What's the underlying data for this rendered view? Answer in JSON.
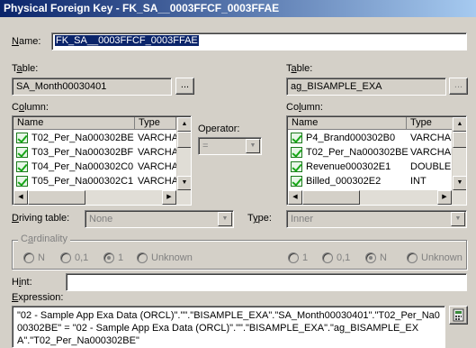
{
  "window": {
    "title": "Physical Foreign Key - FK_SA__0003FFCF_0003FFAE"
  },
  "name": {
    "label": "Name:",
    "value": "FK_SA__0003FFCF_0003FFAE"
  },
  "left": {
    "table_label": "Table:",
    "table_value": "SA_Month00030401",
    "browse_label": "...",
    "column_label": "Column:",
    "headers": {
      "name": "Name",
      "type": "Type"
    },
    "rows": [
      {
        "name": "T02_Per_Na000302BE",
        "type": "VARCHAR"
      },
      {
        "name": "T03_Per_Na000302BF",
        "type": "VARCHAR"
      },
      {
        "name": "T04_Per_Na000302C0",
        "type": "VARCHAR"
      },
      {
        "name": "T05_Per_Na000302C1",
        "type": "VARCHAR"
      }
    ]
  },
  "right": {
    "table_label": "Table:",
    "table_value": "ag_BISAMPLE_EXA",
    "browse_label": "...",
    "column_label": "Column:",
    "headers": {
      "name": "Name",
      "type": "Type"
    },
    "rows": [
      {
        "name": "P4_Brand000302B0",
        "type": "VARCHAR"
      },
      {
        "name": "T02_Per_Na000302BE",
        "type": "VARCHAR"
      },
      {
        "name": "Revenue000302E1",
        "type": "DOUBLE"
      },
      {
        "name": "Billed_000302E2",
        "type": "INT"
      }
    ]
  },
  "operator": {
    "label": "Operator:",
    "value": "="
  },
  "driving_table": {
    "label": "Driving table:",
    "value": "None"
  },
  "type_field": {
    "label": "Type:",
    "value": "Inner"
  },
  "cardinality": {
    "label": "Cardinality",
    "left_options": [
      "N",
      "0,1",
      "1",
      "Unknown"
    ],
    "right_options": [
      "1",
      "0,1",
      "N",
      "Unknown"
    ],
    "left_selected": "1",
    "right_selected": "N"
  },
  "hint": {
    "label": "Hint:",
    "value": ""
  },
  "expression": {
    "label": "Expression:",
    "value": "\"02 - Sample App Exa Data (ORCL)\".\"\".\"BISAMPLE_EXA\".\"SA_Month00030401\".\"T02_Per_Na000302BE\" = \"02 - Sample App Exa Data (ORCL)\".\"\".\"BISAMPLE_EXA\".\"ag_BISAMPLE_EXA\".\"T02_Per_Na000302BE\""
  }
}
